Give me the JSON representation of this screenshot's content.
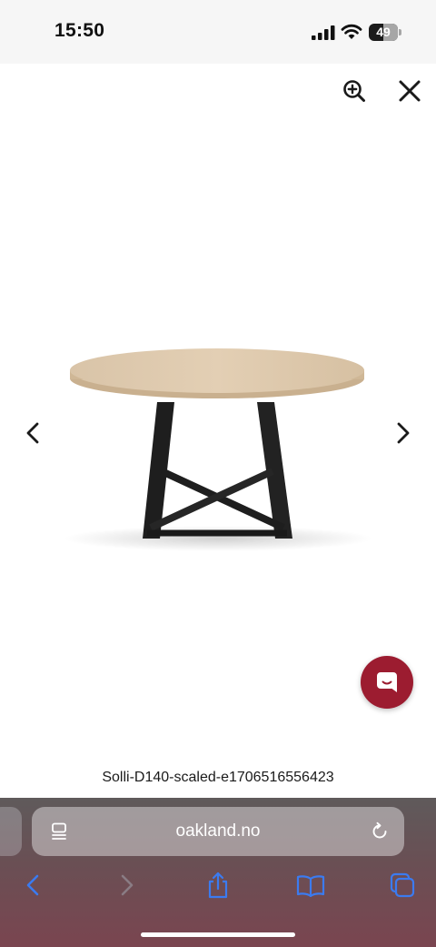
{
  "status_bar": {
    "time": "15:50",
    "battery_level": "49"
  },
  "lightbox": {
    "zoom_icon": "zoom-in-icon",
    "close_icon": "close-icon",
    "prev_icon": "chevron-left-icon",
    "next_icon": "chevron-right-icon",
    "caption": "Solli-D140-scaled-e1706516556423"
  },
  "chat_widget": {
    "icon": "chat-bubble-icon",
    "color": "#9c1c30"
  },
  "browser": {
    "url": "oakland.no",
    "page_menu_icon": "page-menu-icon",
    "reload_icon": "reload-icon",
    "toolbar": [
      "back-icon",
      "forward-icon",
      "share-icon",
      "bookmarks-icon",
      "tabs-icon"
    ],
    "accent": "#3b7bf0"
  }
}
